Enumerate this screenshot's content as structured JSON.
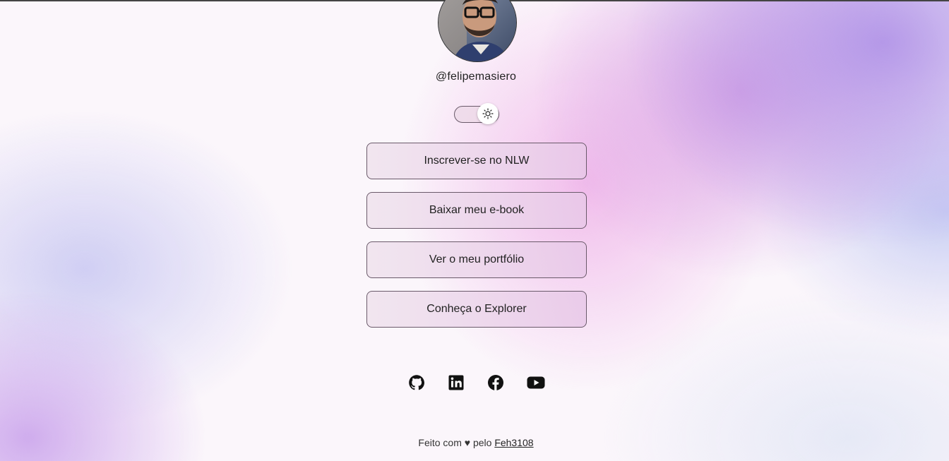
{
  "profile": {
    "username": "@felipemasiero",
    "avatar_icon": "profile-photo"
  },
  "theme_switch": {
    "icon": "sun-icon",
    "state": "light"
  },
  "links": [
    {
      "label": "Inscrever-se no NLW"
    },
    {
      "label": "Baixar meu e-book"
    },
    {
      "label": "Ver o meu portfólio"
    },
    {
      "label": "Conheça o Explorer"
    }
  ],
  "social": [
    {
      "icon": "github-icon"
    },
    {
      "icon": "linkedin-icon"
    },
    {
      "icon": "facebook-icon"
    },
    {
      "icon": "youtube-icon"
    }
  ],
  "footer": {
    "text": "Feito com ♥ pelo ",
    "author": "Feh3108"
  }
}
